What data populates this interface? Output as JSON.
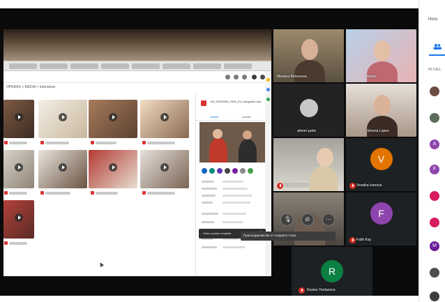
{
  "meeting": {
    "participants": [
      {
        "name": "Mariana Belousova",
        "type": "video",
        "muted": false
      },
      {
        "name": "Nadia",
        "type": "video",
        "muted": false
      },
      {
        "name": "ahmet şahin",
        "type": "video",
        "muted": false
      },
      {
        "name": "Silvana Lopes",
        "type": "video",
        "muted": false
      },
      {
        "name": "Maria Nikolaeva",
        "type": "video",
        "muted": true
      },
      {
        "name": "Veselka Ivanova",
        "type": "avatar",
        "initial": "V",
        "color": "#e37400",
        "muted": true
      },
      {
        "name": "Faith Kay",
        "type": "avatar",
        "initial": "F",
        "color": "#8e44ad",
        "muted": true
      },
      {
        "name": "Rusine Yordanova",
        "type": "avatar",
        "initial": "R",
        "color": "#0b8043",
        "muted": true
      }
    ],
    "tooltip": "Присъединява Ви от гледната точка"
  },
  "shared_screen": {
    "breadcrumb": "OPERAS > MEDIA > Interviews",
    "detail_title": "VID_20200930_1530_E1_Hangouts.mp4",
    "detail_tabs": [
      "Details",
      "Activity"
    ],
    "bottom_pill": "Video upload complete",
    "bottom_pill_close": "×"
  },
  "side_panel": {
    "title": "Hora",
    "section_label": "IN CALL",
    "avatars": [
      {
        "kind": "photo",
        "initial": "",
        "color": "#6d4c41"
      },
      {
        "kind": "photo",
        "initial": "",
        "color": "#5d6d5d"
      },
      {
        "kind": "letter",
        "initial": "A",
        "color": "#8e44ad"
      },
      {
        "kind": "letter",
        "initial": "F",
        "color": "#8e44ad"
      },
      {
        "kind": "letter",
        "initial": "",
        "color": "#d81b60"
      },
      {
        "kind": "letter",
        "initial": "",
        "color": "#d81b60"
      },
      {
        "kind": "letter",
        "initial": "M",
        "color": "#6a1b9a"
      },
      {
        "kind": "photo",
        "initial": "",
        "color": "#4e4e4e"
      },
      {
        "kind": "photo",
        "initial": "",
        "color": "#3e3e3e"
      }
    ]
  },
  "colors": {
    "accent": "#1a73e8",
    "mute_red": "#d93025"
  }
}
